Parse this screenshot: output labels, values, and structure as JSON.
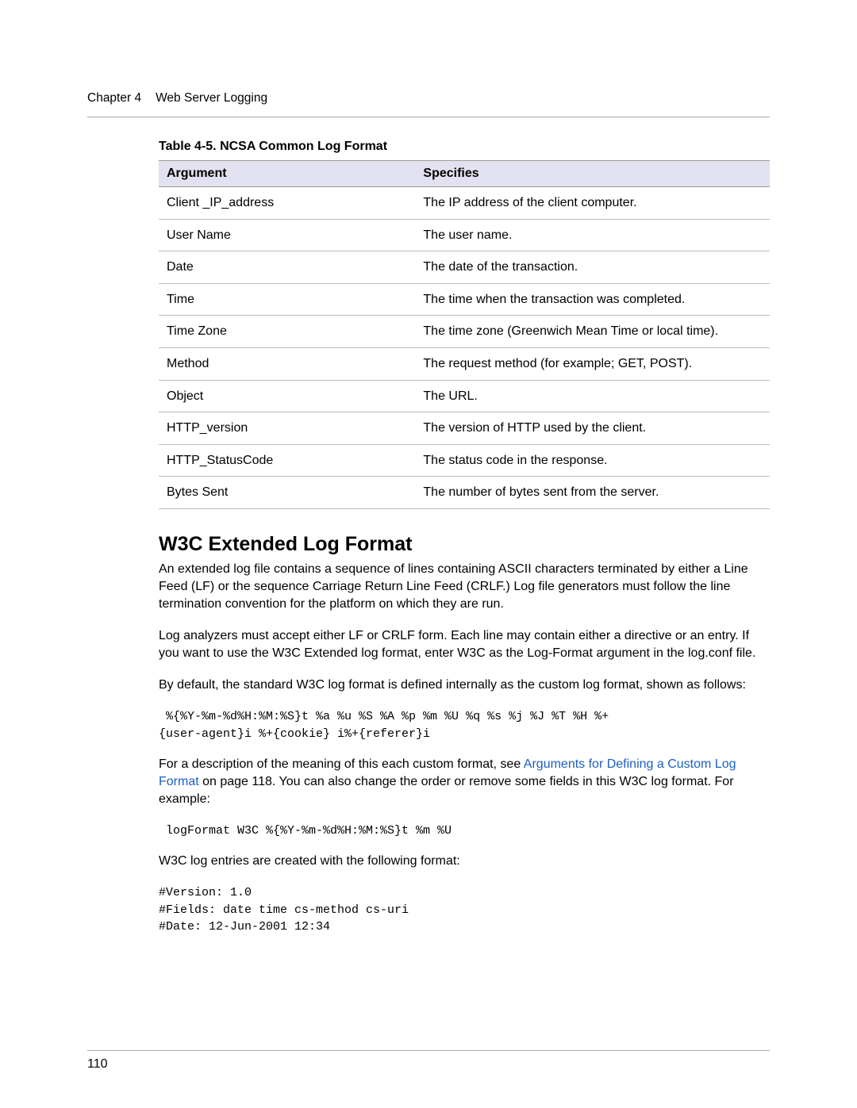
{
  "header": {
    "chapter_label": "Chapter 4",
    "chapter_title": "Web Server Logging"
  },
  "table": {
    "caption": "Table 4-5. NCSA Common Log Format",
    "columns": [
      "Argument",
      "Specifies"
    ],
    "rows": [
      {
        "arg": "Client _IP_address",
        "spec": "The IP address of the client computer."
      },
      {
        "arg": "User Name",
        "spec": "The user name."
      },
      {
        "arg": "Date",
        "spec": "The date of the transaction."
      },
      {
        "arg": "Time",
        "spec": "The time when the transaction was completed."
      },
      {
        "arg": "Time Zone",
        "spec": "The time zone (Greenwich Mean Time or local time)."
      },
      {
        "arg": "Method",
        "spec": "The request method (for example; GET, POST)."
      },
      {
        "arg": "Object",
        "spec": "The URL."
      },
      {
        "arg": "HTTP_version",
        "spec": "The version of HTTP used by the client."
      },
      {
        "arg": "HTTP_StatusCode",
        "spec": "The status code in the response."
      },
      {
        "arg": "Bytes Sent",
        "spec": "The number of bytes sent from the server."
      }
    ]
  },
  "section": {
    "heading": "W3C Extended Log Format",
    "para1": "An extended log file contains a sequence of lines containing ASCII characters terminated by either a Line Feed (LF) or the sequence Carriage Return Line Feed (CRLF.) Log file generators must follow the line termination convention for the platform on which they are run.",
    "para2": "Log analyzers must accept either LF or CRLF form. Each line may contain either a directive or an entry. If you want to use the W3C Extended log format, enter W3C as the Log-Format argument in the log.conf file.",
    "para3": "By default, the standard W3C log format is defined internally as the custom log format, shown as follows:",
    "code1": " %{%Y-%m-%d%H:%M:%S}t %a %u %S %A %p %m %U %q %s %j %J %T %H %+\n{user-agent}i %+{cookie} i%+{referer}i",
    "para4_pre": "For a description of the meaning of this each custom format, see ",
    "para4_link": "Arguments for Defining a Custom Log Format",
    "para4_post": " on page 118. You can also change the order or remove some fields in this W3C log format. For example:",
    "code2": " logFormat W3C %{%Y-%m-%d%H:%M:%S}t %m %U",
    "para5": "W3C log entries are created with the following format:",
    "code3": "#Version: 1.0\n#Fields: date time cs-method cs-uri\n#Date: 12-Jun-2001 12:34"
  },
  "page_number": "110"
}
